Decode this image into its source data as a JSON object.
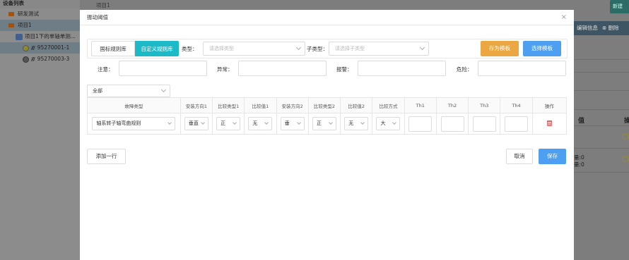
{
  "sidebar": {
    "title": "设备列表",
    "items": [
      {
        "label": "研发测试"
      },
      {
        "label": "项目1"
      },
      {
        "label": "项目1下的单轴单测..."
      },
      {
        "label": "95270001-1",
        "signal": "///"
      },
      {
        "label": "95270003-3",
        "signal": "///"
      }
    ]
  },
  "background": {
    "breadcrumb": "项目1",
    "new_button": "新建",
    "edit_info": "编辑信息",
    "delete": "删除",
    "col_header_1": "值",
    "col_header_2": "操",
    "row1_a": "量:0",
    "row1_b": "量:0"
  },
  "modal": {
    "title": "振动阈值",
    "close": "×",
    "tab_national": "国标规则库",
    "tab_custom": "自定义规则库",
    "type_label": "类型：",
    "type_placeholder": "请选择类型",
    "subtype_label": "子类型：",
    "subtype_placeholder": "请选择子类型",
    "save_template": "存为模板",
    "choose_template": "选择模板",
    "attention_label": "注意：",
    "abnormal_label": "异常：",
    "alarm_label": "报警：",
    "danger_label": "危险：",
    "filter_value": "全部",
    "table": {
      "headers": [
        "故障类型",
        "安装方向1",
        "比较类型1",
        "比较值1",
        "安装方向2",
        "比较类型2",
        "比较值2",
        "比较方式",
        "Th1",
        "Th2",
        "Th3",
        "Th4",
        "操作"
      ],
      "row": {
        "fault_type": "轴系转子轴弯曲规则",
        "dir1": "垂直",
        "cmp_type1": "正",
        "cmp_val1": "无",
        "dir2": "垂",
        "cmp_type2": "正",
        "cmp_val2": "无",
        "cmp_mode": "大"
      }
    },
    "add_row": "添加一行",
    "cancel": "取消",
    "save": "保存"
  },
  "colors": {
    "accent_teal": "#1cbac7",
    "accent_blue": "#4d9ff2",
    "accent_orange": "#eaa742",
    "delete_red": "#e26262"
  }
}
